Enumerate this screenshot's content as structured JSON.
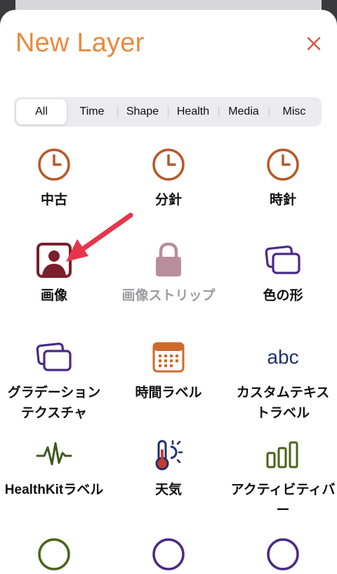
{
  "header": {
    "title": "New Layer",
    "close_icon": "close-x-icon"
  },
  "tabs": [
    {
      "label": "All",
      "selected": true
    },
    {
      "label": "Time",
      "selected": false
    },
    {
      "label": "Shape",
      "selected": false
    },
    {
      "label": "Health",
      "selected": false
    },
    {
      "label": "Media",
      "selected": false
    },
    {
      "label": "Misc",
      "selected": false
    }
  ],
  "layers": [
    {
      "label": "中古",
      "icon": "clock-icon",
      "enabled": true
    },
    {
      "label": "分針",
      "icon": "clock-icon",
      "enabled": true
    },
    {
      "label": "時針",
      "icon": "clock-icon",
      "enabled": true
    },
    {
      "label": "画像",
      "icon": "photo-portrait-icon",
      "enabled": true
    },
    {
      "label": "画像ストリップ",
      "icon": "lock-icon",
      "enabled": false
    },
    {
      "label": "色の形",
      "icon": "stacked-cards-icon",
      "enabled": true
    },
    {
      "label": "グラデーションテクスチャ",
      "icon": "stacked-cards-icon",
      "enabled": true
    },
    {
      "label": "時間ラベル",
      "icon": "calendar-icon",
      "enabled": true
    },
    {
      "label": "カスタムテキストラベル",
      "icon": "abc-text-icon",
      "icon_text": "abc",
      "enabled": true
    },
    {
      "label": "HealthKitラベル",
      "icon": "heartbeat-waveform-icon",
      "enabled": true
    },
    {
      "label": "天気",
      "icon": "thermometer-sun-icon",
      "enabled": true
    },
    {
      "label": "アクティビティバー",
      "icon": "bar-chart-icon",
      "enabled": true
    },
    {
      "label": "",
      "icon": "ring-icon",
      "enabled": true
    },
    {
      "label": "",
      "icon": "ring-icon",
      "enabled": true
    },
    {
      "label": "",
      "icon": "ring-icon",
      "enabled": true
    }
  ],
  "colors": {
    "accent_orange": "#ea8a3c",
    "clock_brown": "#b65a2a",
    "photo_maroon": "#7a1f2b",
    "lock_mauve": "#b88e9c",
    "purple": "#4a2a86",
    "calendar_orange": "#cf6a2c",
    "abc_navy": "#22306e",
    "health_green": "#3f5a1f",
    "ring_olive": "#4b6419",
    "close_red": "#e0523f",
    "annotation_arrow": "#e8344a"
  }
}
